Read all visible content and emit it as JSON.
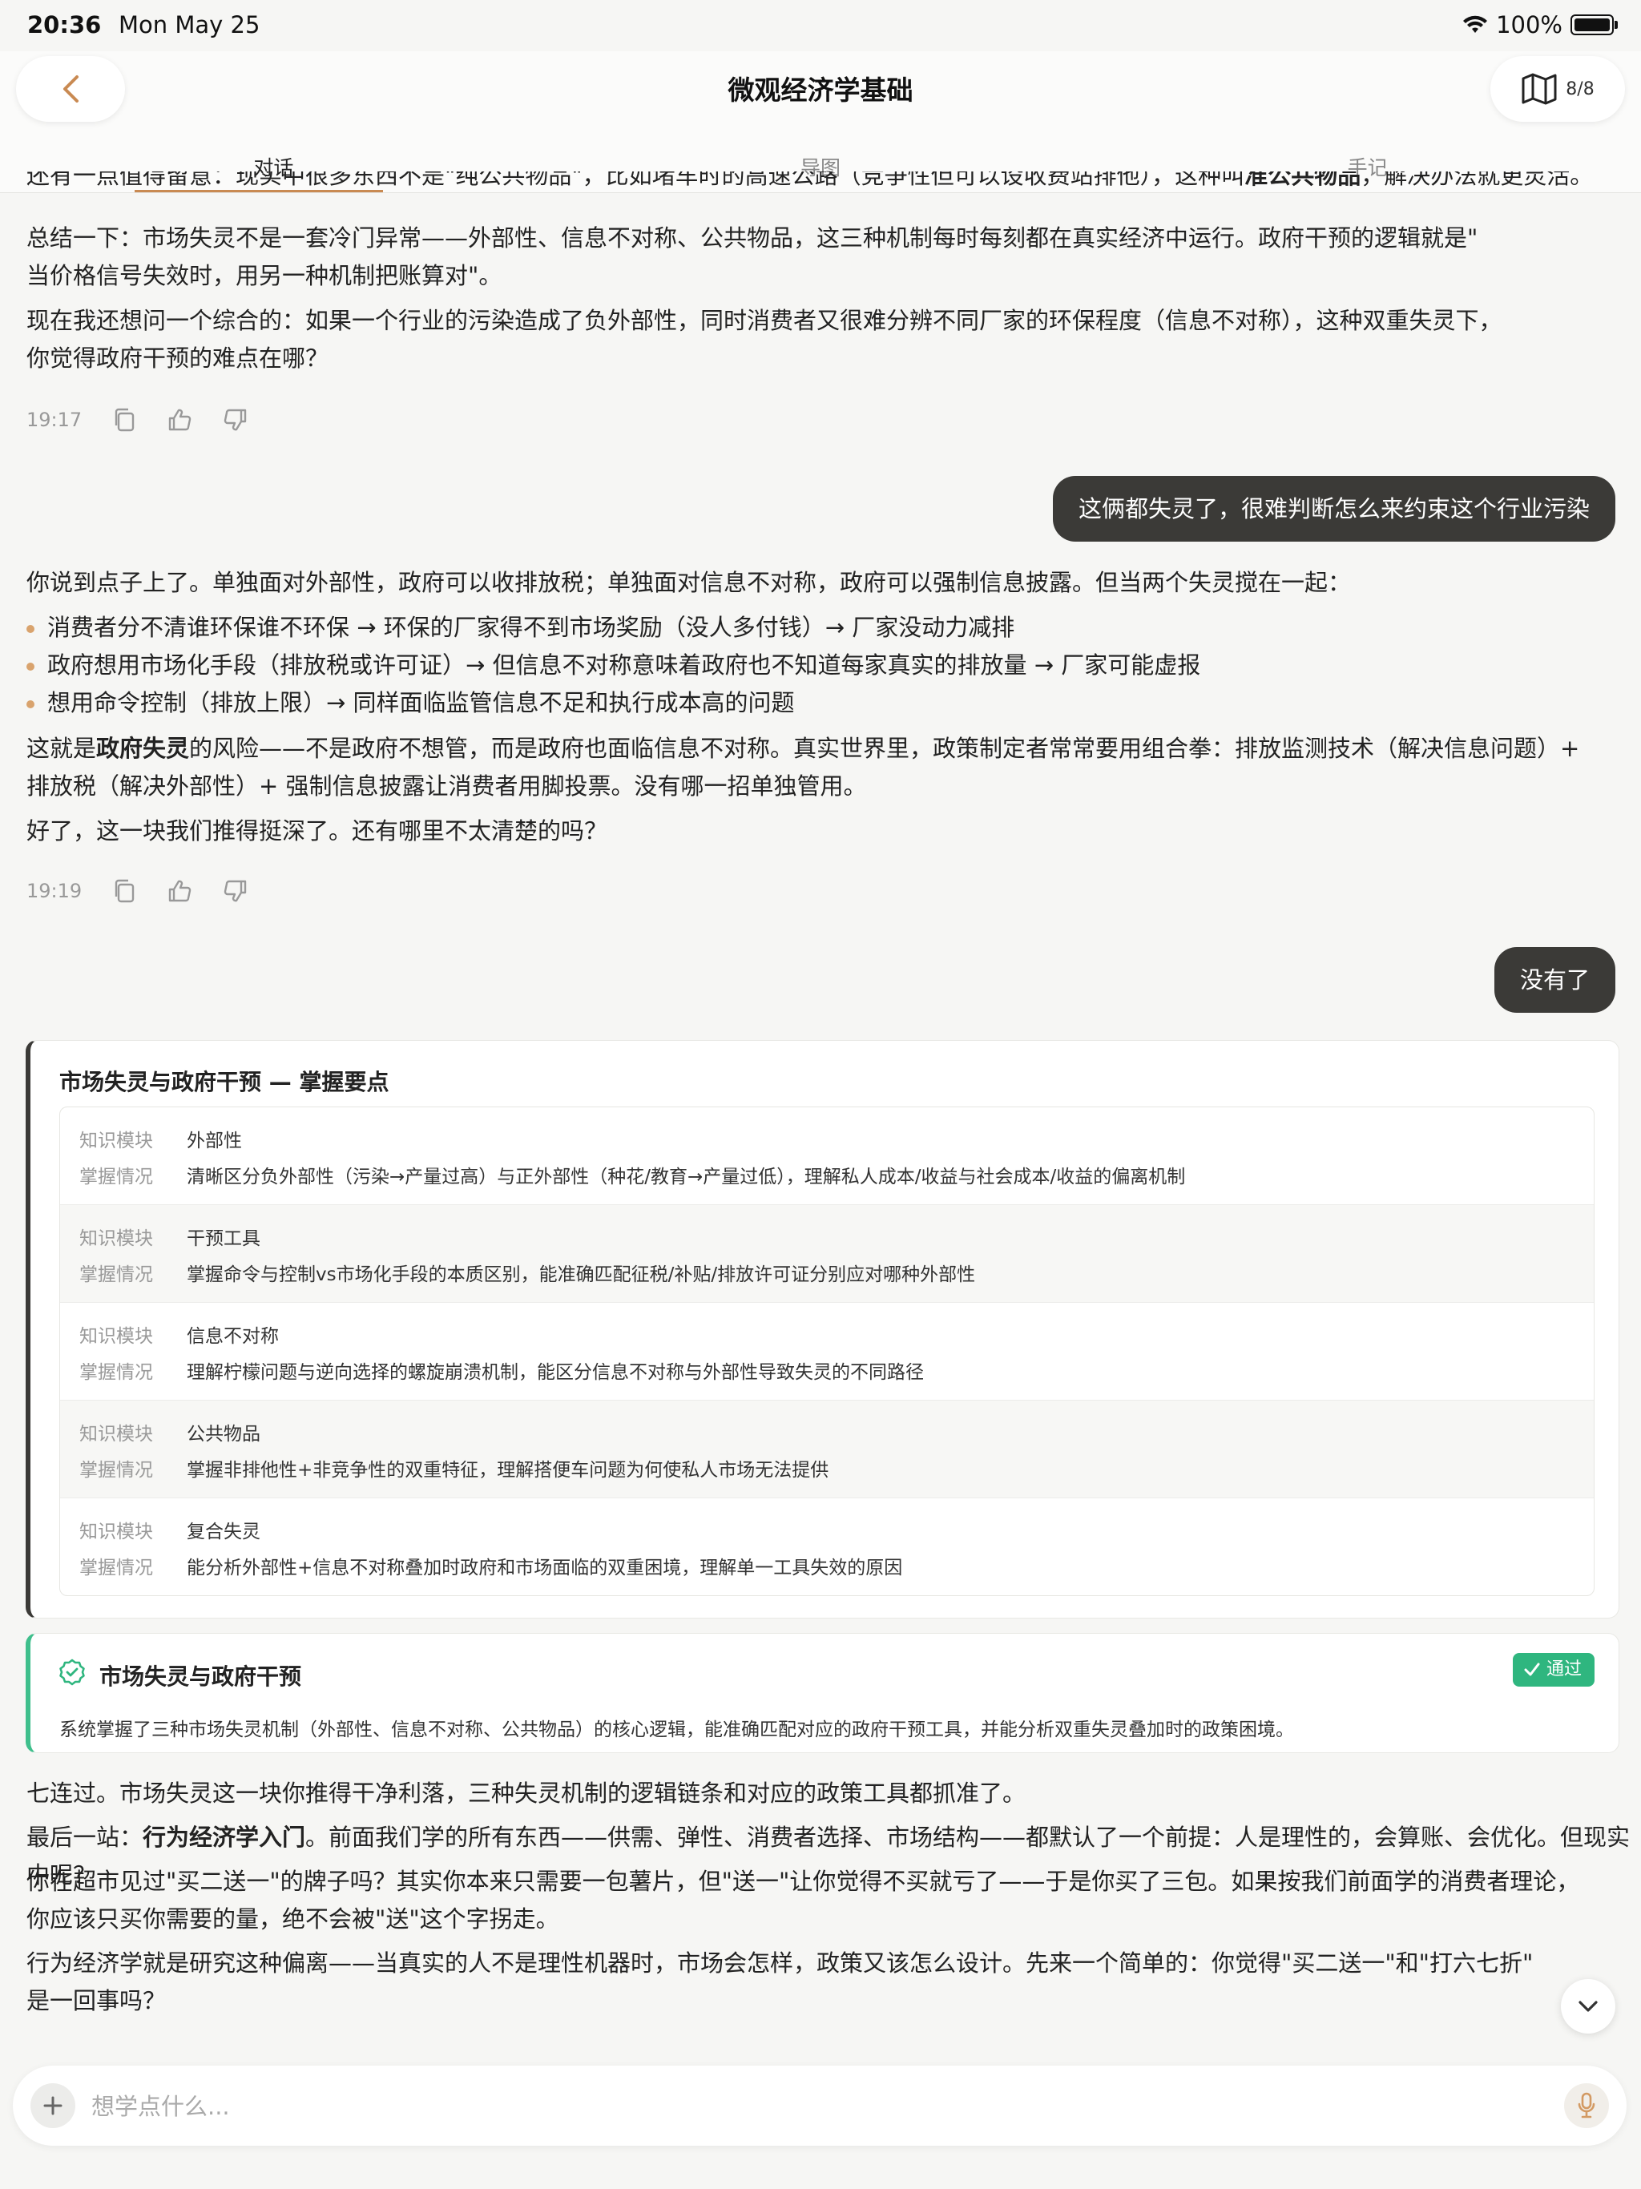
{
  "status": {
    "time": "20:36",
    "date": "Mon May 25",
    "battery": "100%"
  },
  "header": {
    "title": "微观经济学基础",
    "map_count": "8/8"
  },
  "tabs": [
    "对话",
    "导图",
    "手记"
  ],
  "messages": {
    "cut_line_a": "还有一点值得留意：现实中很多东西不是\"纯公共物品\"，比如堵车时的高速公路（竞争性但可以设收费站排他），这种叫",
    "cut_line_bold": "准公共物品",
    "cut_line_b": "，解决办法就更灵活。",
    "ai1_p1_l1": "总结一下：市场失灵不是一套冷门异常——外部性、信息不对称、公共物品，这三种机制每时每刻都在真实经济中运行。政府干预的逻辑就是\"",
    "ai1_p1_l2": "当价格信号失效时，用另一种机制把账算对\"。",
    "ai1_p2_l1": "现在我还想问一个综合的：如果一个行业的污染造成了负外部性，同时消费者又很难分辨不同厂家的环保程度（信息不对称），这种双重失灵下，",
    "ai1_p2_l2": "你觉得政府干预的难点在哪？",
    "ai1_time": "19:17",
    "user1": "这俩都失灵了，很难判断怎么来约束这个行业污染",
    "ai2_intro": "你说到点子上了。单独面对外部性，政府可以收排放税；单独面对信息不对称，政府可以强制信息披露。但当两个失灵搅在一起：",
    "ai2_bullets": [
      "消费者分不清谁环保谁不环保 → 环保的厂家得不到市场奖励（没人多付钱）→ 厂家没动力减排",
      "政府想用市场化手段（排放税或许可证）→ 但信息不对称意味着政府也不知道每家真实的排放量 → 厂家可能虚报",
      "想用命令控制（排放上限）→ 同样面临监管信息不足和执行成本高的问题"
    ],
    "ai2_p2_a": "这就是",
    "ai2_p2_bold": "政府失灵",
    "ai2_p2_b": "的风险——不是政府不想管，而是政府也面临信息不对称。真实世界里，政策制定者常常要用组合拳：排放监测技术（解决信息问题）+",
    "ai2_p2_l2": "排放税（解决外部性）+ 强制信息披露让消费者用脚投票。没有哪一招单独管用。",
    "ai2_p3": "好了，这一块我们推得挺深了。还有哪里不太清楚的吗？",
    "ai2_time": "19:19",
    "user2": "没有了"
  },
  "card": {
    "title": "市场失灵与政府干预 — 掌握要点",
    "key_module": "知识模块",
    "key_status": "掌握情况",
    "rows": [
      {
        "module": "外部性",
        "status": "清晰区分负外部性（污染→产量过高）与正外部性（种花/教育→产量过低），理解私人成本/收益与社会成本/收益的偏离机制"
      },
      {
        "module": "干预工具",
        "status": "掌握命令与控制vs市场化手段的本质区别，能准确匹配征税/补贴/排放许可证分别应对哪种外部性"
      },
      {
        "module": "信息不对称",
        "status": "理解柠檬问题与逆向选择的螺旋崩溃机制，能区分信息不对称与外部性导致失灵的不同路径"
      },
      {
        "module": "公共物品",
        "status": "掌握非排他性+非竞争性的双重特征，理解搭便车问题为何使私人市场无法提供"
      },
      {
        "module": "复合失灵",
        "status": "能分析外部性+信息不对称叠加时政府和市场面临的双重困境，理解单一工具失效的原因"
      }
    ]
  },
  "pass": {
    "title": "市场失灵与政府干预",
    "badge": "通过",
    "desc": "系统掌握了三种市场失灵机制（外部性、信息不对称、公共物品）的核心逻辑，能准确匹配对应的政府干预工具，并能分析双重失灵叠加时的政策困境。"
  },
  "ai3": {
    "p1": "七连过。市场失灵这一块你推得干净利落，三种失灵机制的逻辑链条和对应的政策工具都抓准了。",
    "p2_a": "最后一站：",
    "p2_bold": "行为经济学入门",
    "p2_b": "。前面我们学的所有东西——供需、弹性、消费者选择、市场结构——都默认了一个前提：人是理性的，会算账、会优化。但现实中呢？",
    "p3_l1": "你在超市见过\"买二送一\"的牌子吗？其实你本来只需要一包薯片，但\"送一\"让你觉得不买就亏了——于是你买了三包。如果按我们前面学的消费者理论，",
    "p3_l2": "你应该只买你需要的量，绝不会被\"送\"这个字拐走。",
    "p4_l1": "行为经济学就是研究这种偏离——当真实的人不是理性机器时，市场会怎样，政策又该怎么设计。先来一个简单的：你觉得\"买二送一\"和\"打六七折\"",
    "p4_l2": "是一回事吗？"
  },
  "input": {
    "placeholder": "想学点什么..."
  },
  "colors": {
    "accent": "#c98a52",
    "bubble": "#3b3a37",
    "pass": "#2fb67f"
  }
}
